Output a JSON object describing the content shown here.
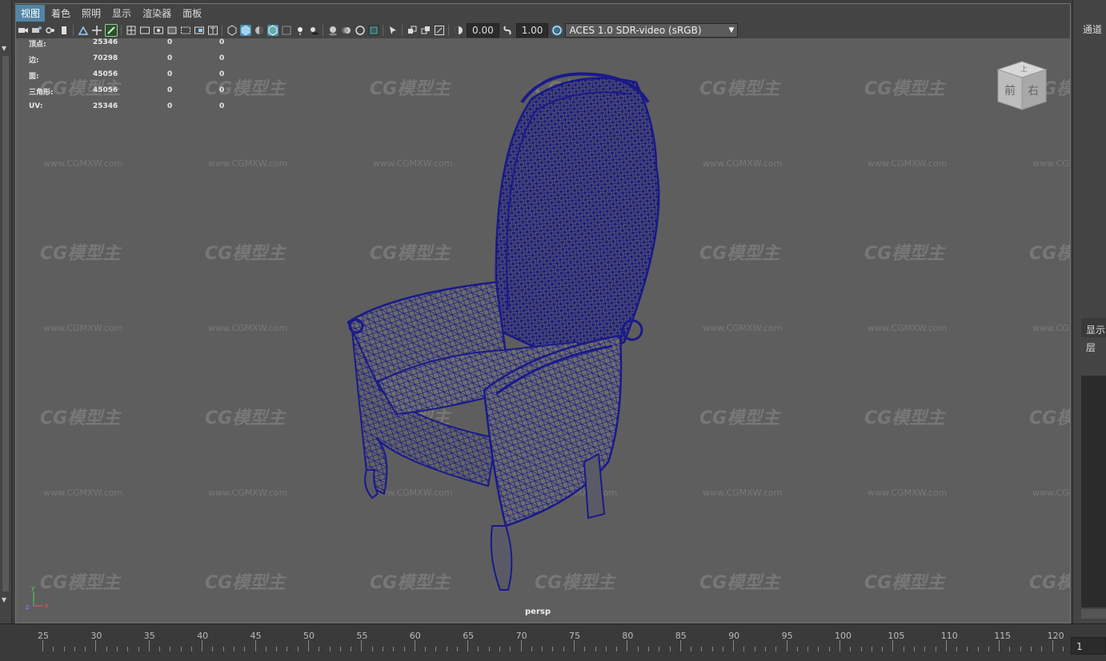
{
  "menu": [
    "视图",
    "着色",
    "照明",
    "显示",
    "渲染器",
    "面板"
  ],
  "menu_active_index": 0,
  "toolbar": {
    "exposure_value": "0.00",
    "gamma_value": "1.00",
    "color_space": "ACES 1.0 SDR-video (sRGB)",
    "icons": [
      "camera-icon",
      "camera-attributes-icon",
      "bookmark-icon",
      "image-plane-icon",
      "2d-pan-icon",
      "grease-pencil-icon",
      "grid-icon",
      "film-gate-icon",
      "resolution-gate-icon",
      "gate-mask-icon",
      "field-chart-icon",
      "safe-action-icon",
      "safe-title-icon",
      "wireframe-icon",
      "smooth-shade-icon",
      "default-material-icon",
      "wireframe-on-shaded-icon",
      "xray-icon",
      "textured-icon",
      "use-all-lights-icon",
      "shadows-icon",
      "screen-space-ao-icon",
      "motion-blur-icon",
      "anti-alias-icon",
      "isolate-select-icon",
      "xray-active-icon",
      "xray-joints-icon",
      "backface-culling-icon",
      "exposure-icon",
      "gamma-icon",
      "color-management-icon"
    ]
  },
  "hud": {
    "rows": [
      {
        "label": "顶点:",
        "a": "25346",
        "b": "0",
        "c": "0"
      },
      {
        "label": "边:",
        "a": "70298",
        "b": "0",
        "c": "0"
      },
      {
        "label": "面:",
        "a": "45056",
        "b": "0",
        "c": "0"
      },
      {
        "label": "三角形:",
        "a": "45056",
        "b": "0",
        "c": "0"
      },
      {
        "label": "UV:",
        "a": "25346",
        "b": "0",
        "c": "0"
      }
    ]
  },
  "viewcube": {
    "front": "前",
    "right": "右",
    "top": "上"
  },
  "camera_label": "persp",
  "axis": {
    "x": "x",
    "y": "y",
    "z": "z"
  },
  "watermark": {
    "logo": "CG模型主",
    "url": "www.CGMXW.com"
  },
  "right_panel": {
    "channels_label": "通道",
    "display_label": "显示",
    "layer_label": "层"
  },
  "timeline": {
    "ticks": [
      "25",
      "30",
      "35",
      "40",
      "45",
      "50",
      "55",
      "60",
      "65",
      "70",
      "75",
      "80",
      "85",
      "90",
      "95",
      "100",
      "105",
      "110",
      "115",
      "120"
    ],
    "current_frame": "1"
  },
  "colors": {
    "viewport_bg": "#5e5e5e",
    "wire": "#1a1a8a",
    "accent": "#5285a6"
  }
}
